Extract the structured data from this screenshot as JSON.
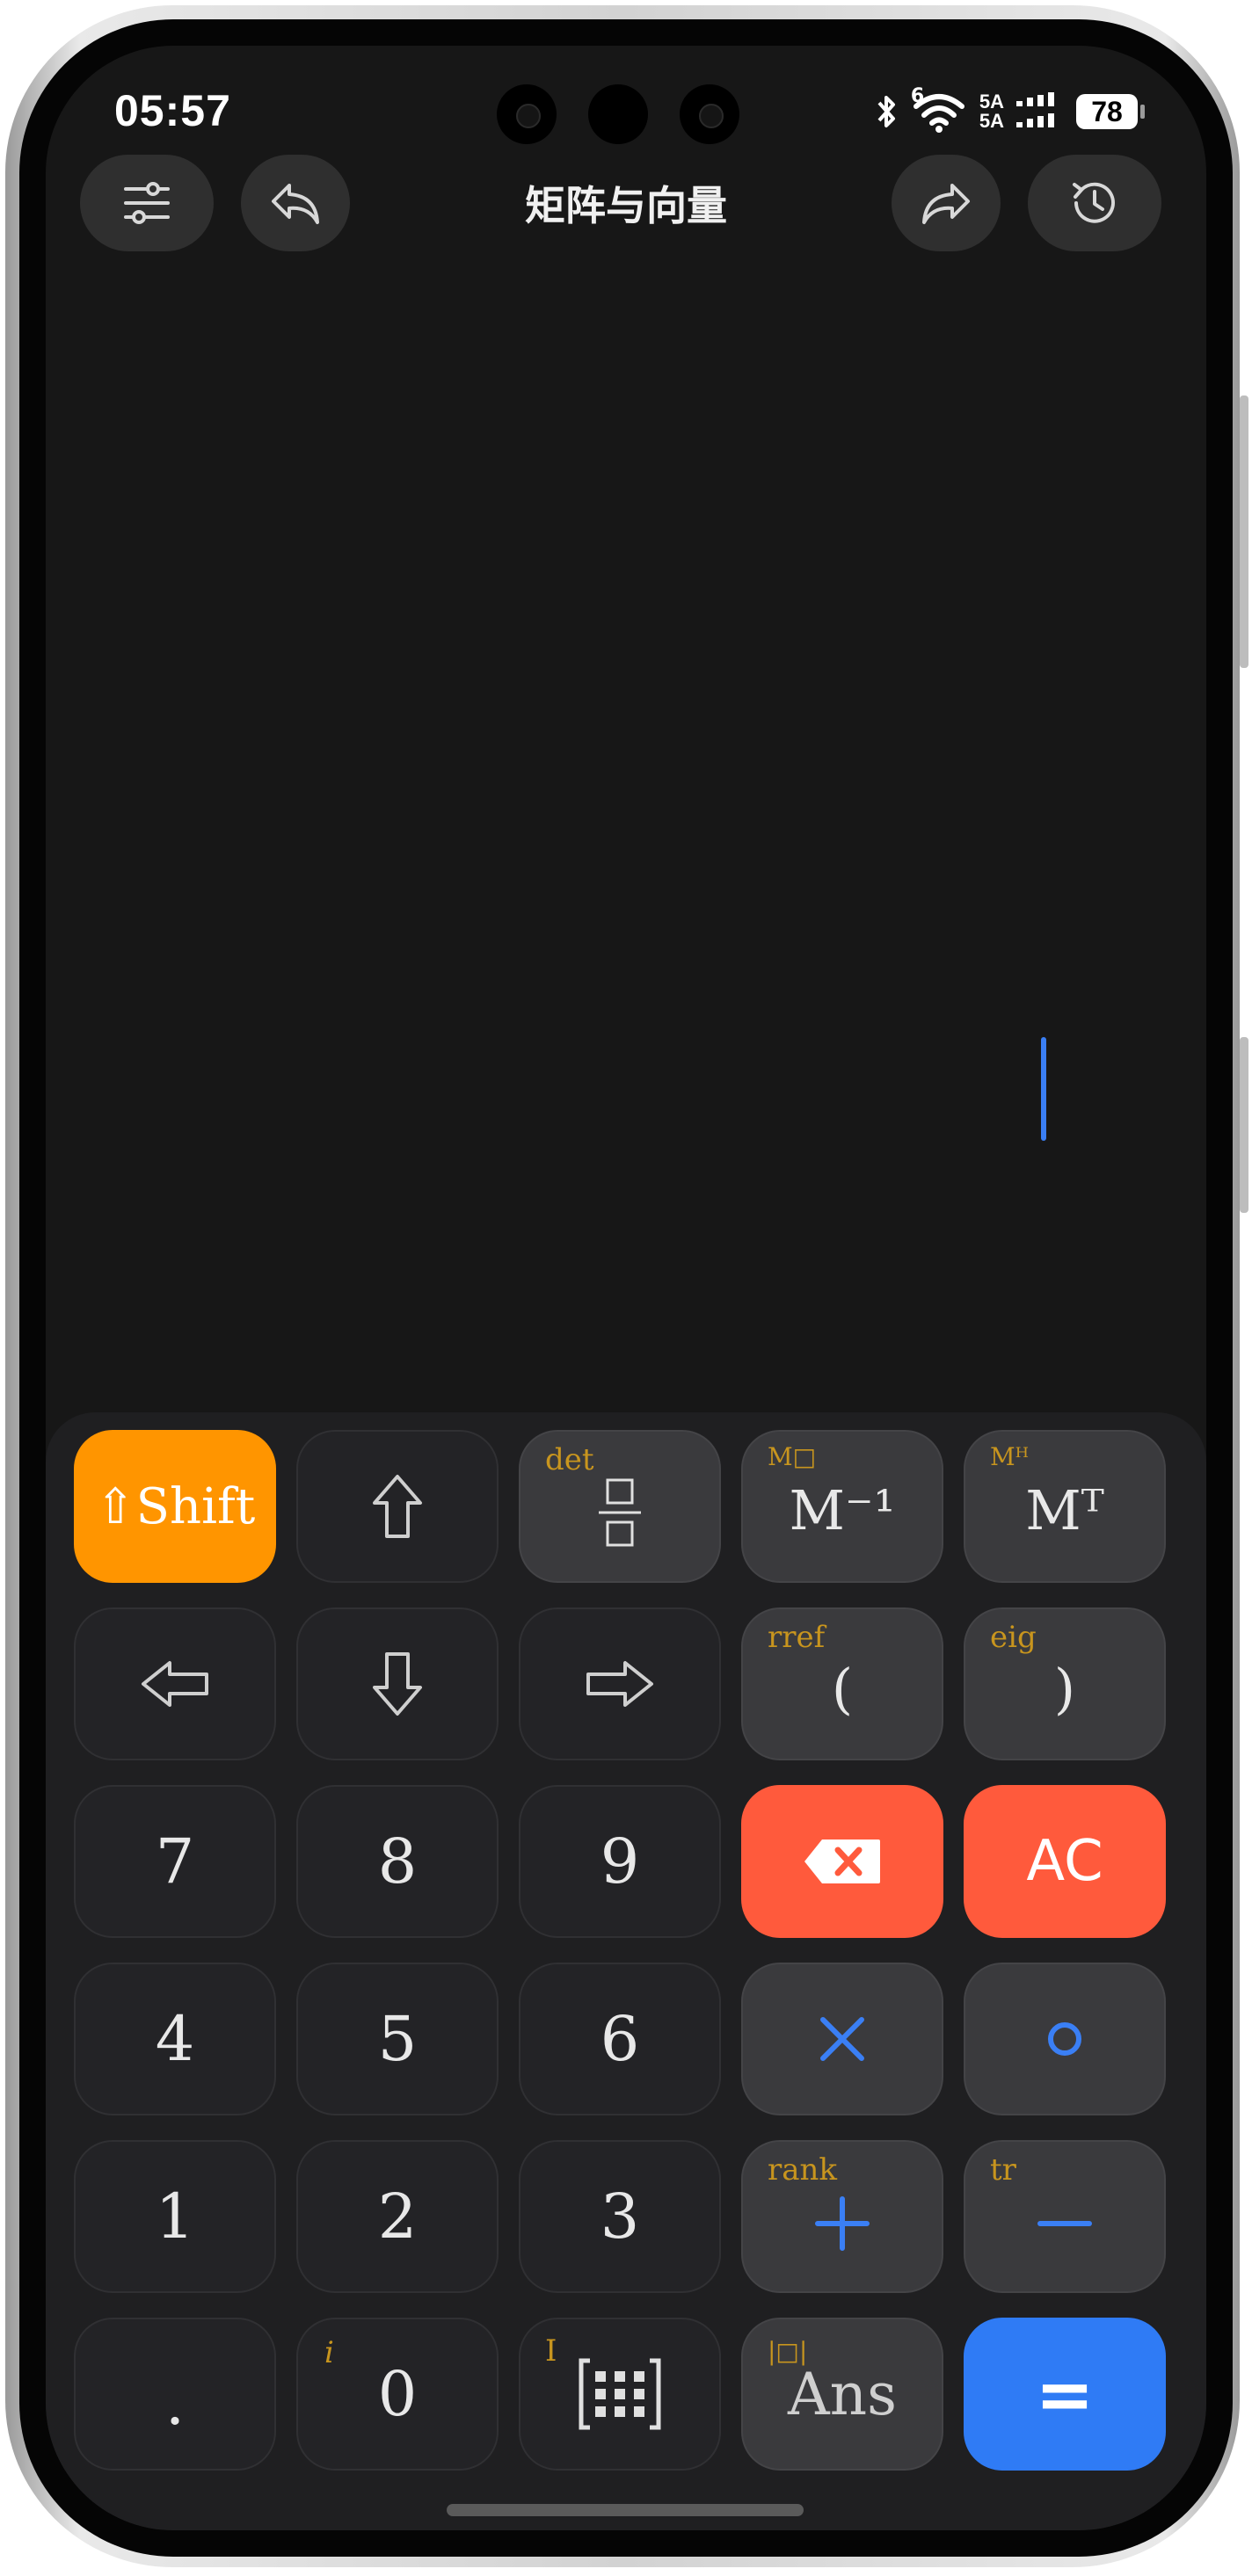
{
  "status": {
    "time": "05:57",
    "network": [
      "5A",
      "5A"
    ],
    "wifi_sub": "6",
    "battery": "78"
  },
  "toolbar": {
    "title": "矩阵与向量"
  },
  "keys": {
    "shift": "⇧Shift",
    "det": "det",
    "m_sq_sec": "M□",
    "m_inv": "M⁻¹",
    "m_h_sec": "Mᴴ",
    "m_t": "Mᵀ",
    "rref": "rref",
    "lparen": "(",
    "eig": "eig",
    "rparen": ")",
    "seven": "7",
    "eight": "8",
    "nine": "9",
    "ac": "AC",
    "four": "4",
    "five": "5",
    "six": "6",
    "one": "1",
    "two": "2",
    "three": "3",
    "rank": "rank",
    "tr": "tr",
    "dot": ".",
    "i_sec": "i",
    "zero": "0",
    "I_sec": "I",
    "abs_sec": "|□|",
    "ans": "Ans",
    "equals": "="
  },
  "colors": {
    "shift": "#ff9500",
    "delete": "#ff5a3c",
    "equals": "#2f7bf5",
    "secondary_label": "#c8951e",
    "operator": "#3a7ff5"
  }
}
